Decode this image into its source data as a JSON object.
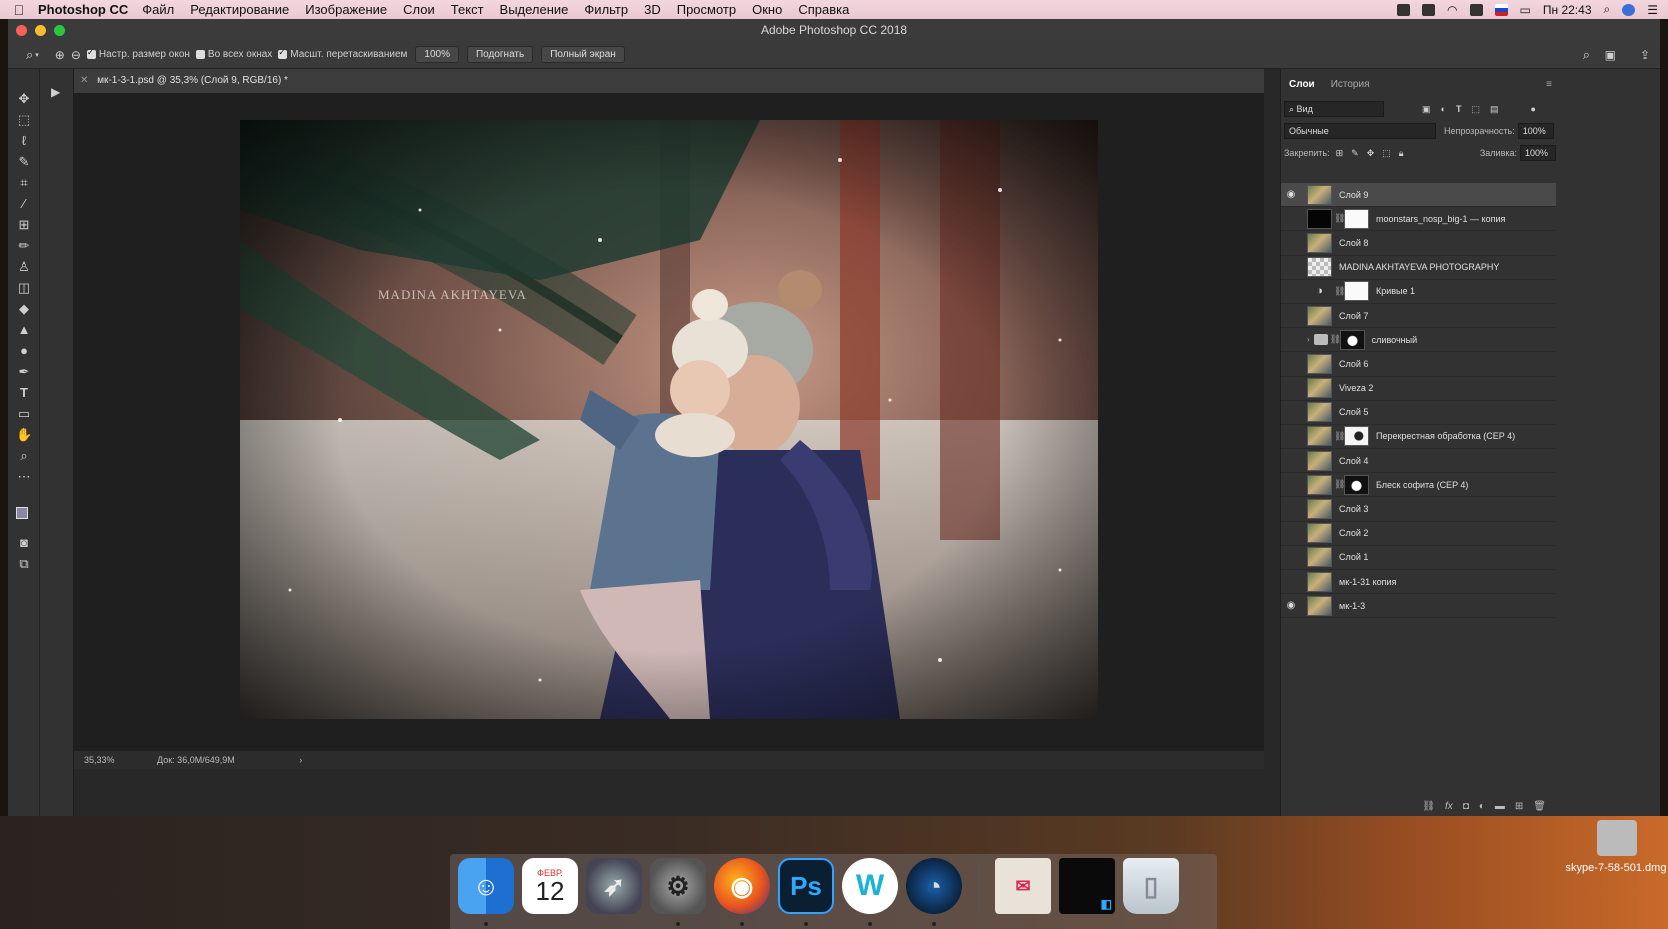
{
  "menubar": {
    "app": "Photoshop CC",
    "items": [
      "Файл",
      "Редактирование",
      "Изображение",
      "Слои",
      "Текст",
      "Выделение",
      "Фильтр",
      "3D",
      "Просмотр",
      "Окно",
      "Справка"
    ],
    "clock": "Пн 22:43"
  },
  "window": {
    "title": "Adobe Photoshop CC 2018"
  },
  "options": {
    "fit_windows": "Настр. размер окон",
    "all_windows": "Во всех окнах",
    "scrubby_zoom": "Масшт. перетаскиванием",
    "zoom_value": "100%",
    "fit_button": "Подогнать",
    "fullscreen_button": "Полный экран"
  },
  "document": {
    "tab": "мк-1-3-1.psd @ 35,3% (Слой 9, RGB/16) *",
    "watermark": "MADINA AKHTAYEVA",
    "zoom": "35,33%",
    "doc_size": "Док: 36,0M/649,9M"
  },
  "layers_panel": {
    "tab_layers": "Слои",
    "tab_history": "История",
    "filter": "Вид",
    "blend_mode": "Обычные",
    "opacity_label": "Непрозрачность:",
    "opacity_value": "100%",
    "lock_label": "Закрепить:",
    "fill_label": "Заливка:",
    "fill_value": "100%",
    "layers": [
      {
        "name": "Слой 9",
        "visible": true,
        "selected": true
      },
      {
        "name": "moonstars_nosp_big-1 — копия",
        "visible": false
      },
      {
        "name": "Слой 8",
        "visible": false
      },
      {
        "name": "MADINA AKHTAYEVA PHOTOGRAPHY",
        "visible": false
      },
      {
        "name": "Кривые 1",
        "visible": false
      },
      {
        "name": "Слой 7",
        "visible": false
      },
      {
        "name": "сливочный",
        "visible": false
      },
      {
        "name": "Слой 6",
        "visible": false
      },
      {
        "name": "Viveza 2",
        "visible": false
      },
      {
        "name": "Слой 5",
        "visible": false
      },
      {
        "name": "Перекрестная обработка (CEP 4)",
        "visible": false
      },
      {
        "name": "Слой 4",
        "visible": false
      },
      {
        "name": "Блеск софита (CEP 4)",
        "visible": false
      },
      {
        "name": "Слой 3",
        "visible": false
      },
      {
        "name": "Слой 2",
        "visible": false
      },
      {
        "name": "Слой 1",
        "visible": false
      },
      {
        "name": "мк-1-31 копия",
        "visible": false
      },
      {
        "name": "мк-1-3",
        "visible": true
      }
    ]
  },
  "dock": {
    "calendar_month": "ФЕВР.",
    "calendar_day": "12",
    "ps_label": "Ps",
    "w_label": "W"
  },
  "desktop": {
    "file_label": "skype-7-58-501.dmg"
  }
}
